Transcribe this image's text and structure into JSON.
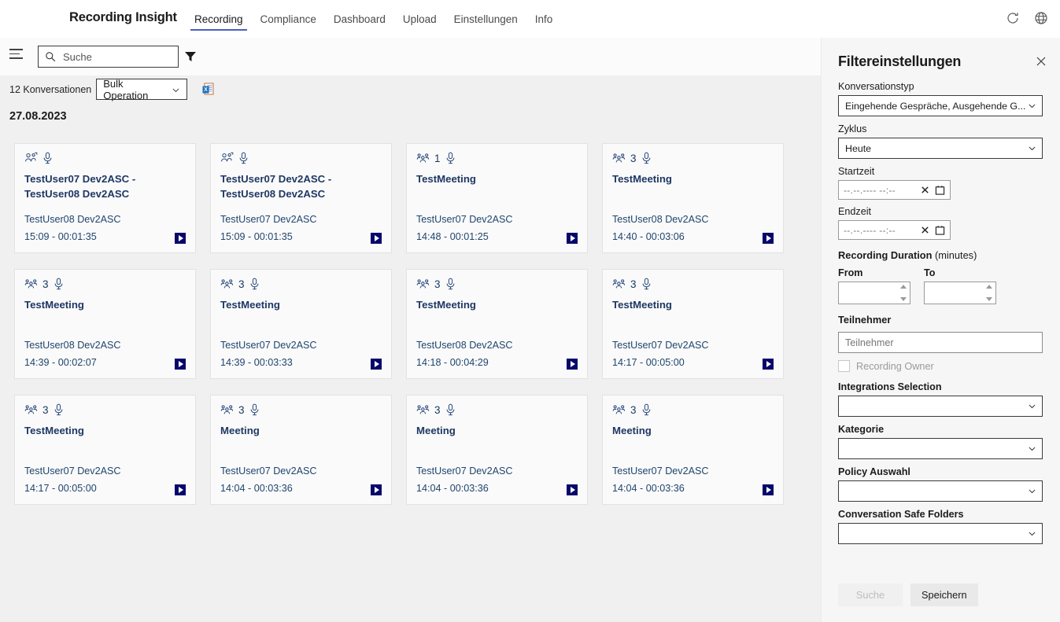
{
  "app": {
    "brand": "Recording Insight",
    "nav": [
      {
        "label": "Recording",
        "active": true
      },
      {
        "label": "Compliance",
        "active": false
      },
      {
        "label": "Dashboard",
        "active": false
      },
      {
        "label": "Upload",
        "active": false
      },
      {
        "label": "Einstellungen",
        "active": false
      },
      {
        "label": "Info",
        "active": false
      }
    ],
    "top_icons": [
      {
        "name": "refresh-icon"
      },
      {
        "name": "globe-icon"
      }
    ]
  },
  "search": {
    "placeholder": "Suche",
    "value": "",
    "icon": "search-icon",
    "filter_icon": "filter-icon",
    "menu_icon": "hamburger-icon"
  },
  "toolbar": {
    "conversation_count": "12 Konversationen",
    "bulk_operation_label": "Bulk Operation",
    "export_icon": "excel-export-icon"
  },
  "list": {
    "date_header": "27.08.2023",
    "cards": [
      {
        "icon": "call-participants-icon",
        "count": "",
        "mic_icon": "microphone-icon",
        "title": "TestUser07 Dev2ASC - TestUser08 Dev2ASC",
        "owner": "TestUser08 Dev2ASC",
        "time": "15:09 - 00:01:35"
      },
      {
        "icon": "call-participants-icon",
        "count": "",
        "mic_icon": "microphone-icon",
        "title": "TestUser07 Dev2ASC - TestUser08 Dev2ASC",
        "owner": "TestUser07 Dev2ASC",
        "time": "15:09 - 00:01:35"
      },
      {
        "icon": "meeting-participants-icon",
        "count": "1",
        "mic_icon": "microphone-icon",
        "title": "TestMeeting",
        "owner": "TestUser07 Dev2ASC",
        "time": "14:48 - 00:01:25"
      },
      {
        "icon": "meeting-participants-icon",
        "count": "3",
        "mic_icon": "microphone-icon",
        "title": "TestMeeting",
        "owner": "TestUser08 Dev2ASC",
        "time": "14:40 - 00:03:06"
      },
      {
        "icon": "meeting-participants-icon",
        "count": "3",
        "mic_icon": "microphone-icon",
        "title": "TestMeeting",
        "owner": "TestUser08 Dev2ASC",
        "time": "14:39 - 00:02:07"
      },
      {
        "icon": "meeting-participants-icon",
        "count": "3",
        "mic_icon": "microphone-icon",
        "title": "TestMeeting",
        "owner": "TestUser07 Dev2ASC",
        "time": "14:39 - 00:03:33"
      },
      {
        "icon": "meeting-participants-icon",
        "count": "3",
        "mic_icon": "microphone-icon",
        "title": "TestMeeting",
        "owner": "TestUser08 Dev2ASC",
        "time": "14:18 - 00:04:29"
      },
      {
        "icon": "meeting-participants-icon",
        "count": "3",
        "mic_icon": "microphone-icon",
        "title": "TestMeeting",
        "owner": "TestUser07 Dev2ASC",
        "time": "14:17 - 00:05:00"
      },
      {
        "icon": "meeting-participants-icon",
        "count": "3",
        "mic_icon": "microphone-icon",
        "title": "TestMeeting",
        "owner": "TestUser07 Dev2ASC",
        "time": "14:17 - 00:05:00"
      },
      {
        "icon": "meeting-participants-icon",
        "count": "3",
        "mic_icon": "microphone-icon",
        "title": "Meeting",
        "owner": "TestUser07 Dev2ASC",
        "time": "14:04 - 00:03:36"
      },
      {
        "icon": "meeting-participants-icon",
        "count": "3",
        "mic_icon": "microphone-icon",
        "title": "Meeting",
        "owner": "TestUser07 Dev2ASC",
        "time": "14:04 - 00:03:36"
      },
      {
        "icon": "meeting-participants-icon",
        "count": "3",
        "mic_icon": "microphone-icon",
        "title": "Meeting",
        "owner": "TestUser07 Dev2ASC",
        "time": "14:04 - 00:03:36"
      }
    ],
    "play_icon": "play-icon"
  },
  "filter_panel": {
    "title": "Filtereinstellungen",
    "close_icon": "close-icon",
    "conversation_type": {
      "label": "Konversationstyp",
      "value": "Eingehende Gespräche, Ausgehende G..."
    },
    "cycle": {
      "label": "Zyklus",
      "value": "Heute"
    },
    "start_time": {
      "label": "Startzeit",
      "placeholder": "--.--.---- --:--",
      "clear_icon": "close-icon",
      "calendar_icon": "calendar-icon"
    },
    "end_time": {
      "label": "Endzeit",
      "placeholder": "--.--.---- --:--",
      "clear_icon": "close-icon",
      "calendar_icon": "calendar-icon"
    },
    "recording_duration": {
      "label_bold": "Recording Duration",
      "label_light": "(minutes)",
      "from_label": "From",
      "from_value": "",
      "to_label": "To",
      "to_value": ""
    },
    "participants": {
      "label": "Teilnehmer",
      "placeholder": "Teilnehmer",
      "value": ""
    },
    "recording_owner": {
      "label": "Recording Owner",
      "checked": false
    },
    "integrations_selection": {
      "label": "Integrations Selection",
      "value": ""
    },
    "kategorie": {
      "label": "Kategorie",
      "value": ""
    },
    "policy_auswahl": {
      "label": "Policy Auswahl",
      "value": ""
    },
    "conversation_safe_folders": {
      "label": "Conversation Safe Folders",
      "value": ""
    },
    "buttons": {
      "search": "Suche",
      "save": "Speichern"
    }
  },
  "colors": {
    "accent": "#4a5fc1",
    "card_title": "#1f3864",
    "play_button": "#07076b",
    "panel_bg": "#f6f6f6"
  }
}
